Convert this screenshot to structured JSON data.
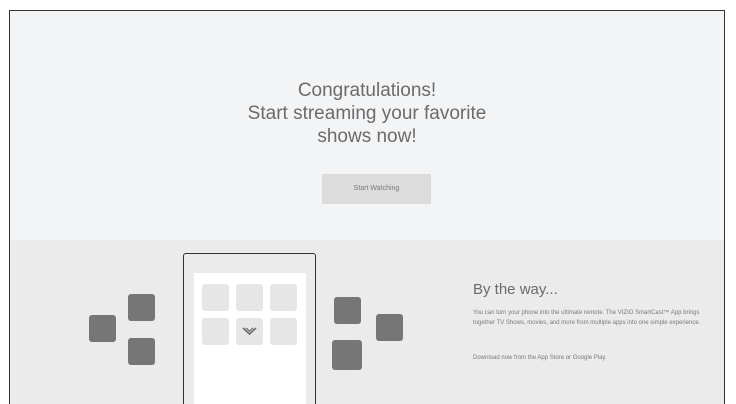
{
  "hero": {
    "title_lines": [
      "Congratulations!",
      "Start streaming your favorite",
      "shows now!"
    ],
    "button_label": "Start Watching"
  },
  "promo": {
    "title": "By the way...",
    "body": "You can turn your phone into the ultimate remote. The VIZIO SmartCast™ App brings together TV Shows, movies, and more from multiple apps into one simple experience.",
    "download_text": "Download now from the App Store or Google Play.",
    "logo_icon": "vizio-v-icon"
  },
  "colors": {
    "hero_bg": "#f3f4f6",
    "lower_bg": "#ebebeb",
    "button_bg": "#dcdcdc",
    "square_fill": "#767676",
    "tile_fill": "#e6e6e6"
  }
}
